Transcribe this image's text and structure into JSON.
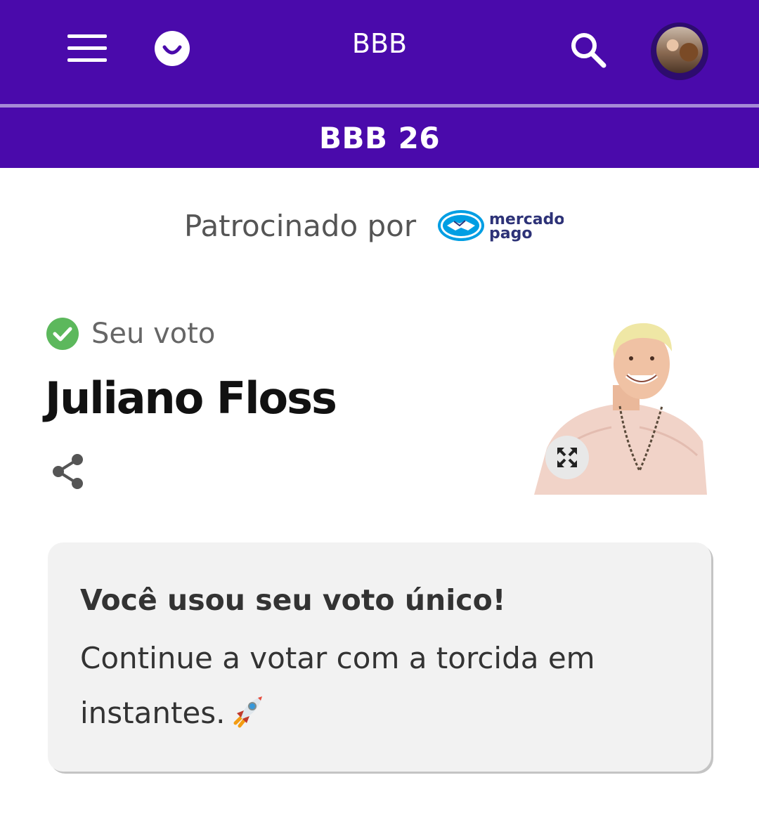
{
  "header": {
    "title": "BBB",
    "menu_icon": "hamburger-menu-icon",
    "logo_icon": "smile-logo-icon",
    "search_icon": "search-icon",
    "avatar": "user-avatar"
  },
  "subheader": {
    "title": "BBB 26"
  },
  "sponsor": {
    "label": "Patrocinado por",
    "brand_line1": "mercado",
    "brand_line2": "pago"
  },
  "vote": {
    "status_label": "Seu voto",
    "participant_name": "Juliano Floss",
    "share_icon": "share-icon",
    "expand_icon": "expand-icon"
  },
  "info_card": {
    "title": "Você usou seu voto único!",
    "body": "Continue a votar com a torcida em instantes."
  },
  "colors": {
    "brand_purple": "#4a0aab",
    "check_green": "#5cb85c",
    "card_background": "#f2f2f2",
    "mercado_pago_blue": "#009ee3",
    "mercado_pago_navy": "#2d3277"
  }
}
